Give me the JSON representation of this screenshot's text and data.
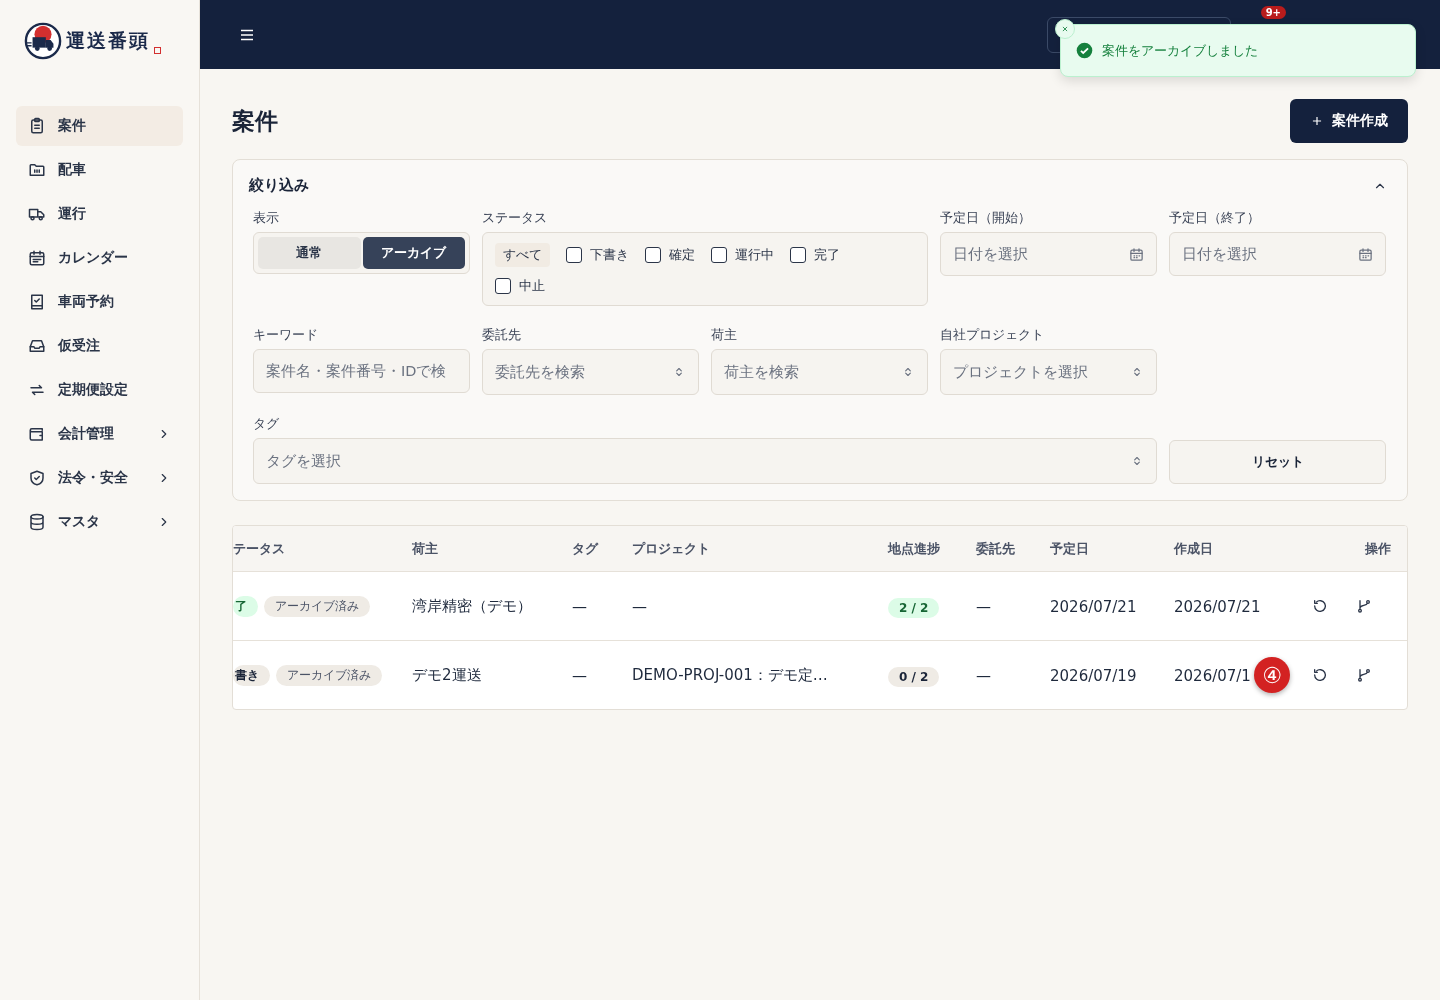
{
  "sidebar": {
    "logo": {
      "text": "運送番頭"
    },
    "items": [
      {
        "label": "案件",
        "selected": true,
        "expandable": false
      },
      {
        "label": "配車",
        "selected": false,
        "expandable": false
      },
      {
        "label": "運行",
        "selected": false,
        "expandable": false
      },
      {
        "label": "カレンダー",
        "selected": false,
        "expandable": false
      },
      {
        "label": "車両予約",
        "selected": false,
        "expandable": false
      },
      {
        "label": "仮受注",
        "selected": false,
        "expandable": false
      },
      {
        "label": "定期便設定",
        "selected": false,
        "expandable": false
      },
      {
        "label": "会計管理",
        "selected": false,
        "expandable": true
      },
      {
        "label": "法令・安全",
        "selected": false,
        "expandable": true
      },
      {
        "label": "マスタ",
        "selected": false,
        "expandable": true
      }
    ]
  },
  "header": {
    "notification_badge": "9+"
  },
  "toast": {
    "message": "案件をアーカイブしました"
  },
  "page": {
    "title": "案件",
    "create_button": "案件作成"
  },
  "filters": {
    "title": "絞り込み",
    "expanded": true,
    "fields": [
      {
        "kind": "toggle",
        "label": "表示",
        "options": [
          {
            "label": "通常",
            "selected": false
          },
          {
            "label": "アーカイブ",
            "selected": true
          }
        ]
      },
      {
        "kind": "checks",
        "label": "ステータス",
        "all": "すべて",
        "options": [
          {
            "label": "下書き",
            "checked": false
          },
          {
            "label": "確定",
            "checked": false
          },
          {
            "label": "運行中",
            "checked": false
          },
          {
            "label": "完了",
            "checked": false
          },
          {
            "label": "中止",
            "checked": false
          }
        ]
      },
      {
        "kind": "date",
        "label": "予定日（開始）",
        "placeholder": "日付を選択"
      },
      {
        "kind": "date",
        "label": "予定日（終了）",
        "placeholder": "日付を選択"
      },
      {
        "kind": "text",
        "label": "キーワード",
        "placeholder": "案件名・案件番号・IDで検"
      },
      {
        "kind": "select",
        "label": "委託先",
        "placeholder": "委託先を検索"
      },
      {
        "kind": "select",
        "label": "荷主",
        "placeholder": "荷主を検索"
      },
      {
        "kind": "select",
        "label": "自社プロジェクト",
        "placeholder": "プロジェクトを選択"
      },
      {
        "kind": "select",
        "label": "タグ",
        "placeholder": "タグを選択"
      },
      {
        "kind": "button",
        "label": "リセット"
      }
    ]
  },
  "table": {
    "columns": [
      "テータス",
      "荷主",
      "タグ",
      "プロジェクト",
      "地点進捗",
      "委託先",
      "予定日",
      "作成日",
      "操作"
    ],
    "rows": [
      {
        "status": [
          {
            "label": "了",
            "kind": "done"
          },
          {
            "label": "アーカイブ済み",
            "kind": "archived"
          }
        ],
        "shipper": "湾岸精密（デモ）",
        "tag": "—",
        "project": "—",
        "progress": "2 / 2",
        "progress_complete": true,
        "carrier": "—",
        "scheduled": "2026/07/21",
        "created": "2026/07/21",
        "marker": ""
      },
      {
        "status": [
          {
            "label": "書き",
            "kind": "draft"
          },
          {
            "label": "アーカイブ済み",
            "kind": "archived"
          }
        ],
        "shipper": "デモ2運送",
        "tag": "—",
        "project": "DEMO-PROJ-001：デモ定…",
        "progress": "0 / 2",
        "progress_complete": false,
        "carrier": "—",
        "scheduled": "2026/07/19",
        "created": "2026/07/1",
        "marker": "④"
      }
    ]
  }
}
